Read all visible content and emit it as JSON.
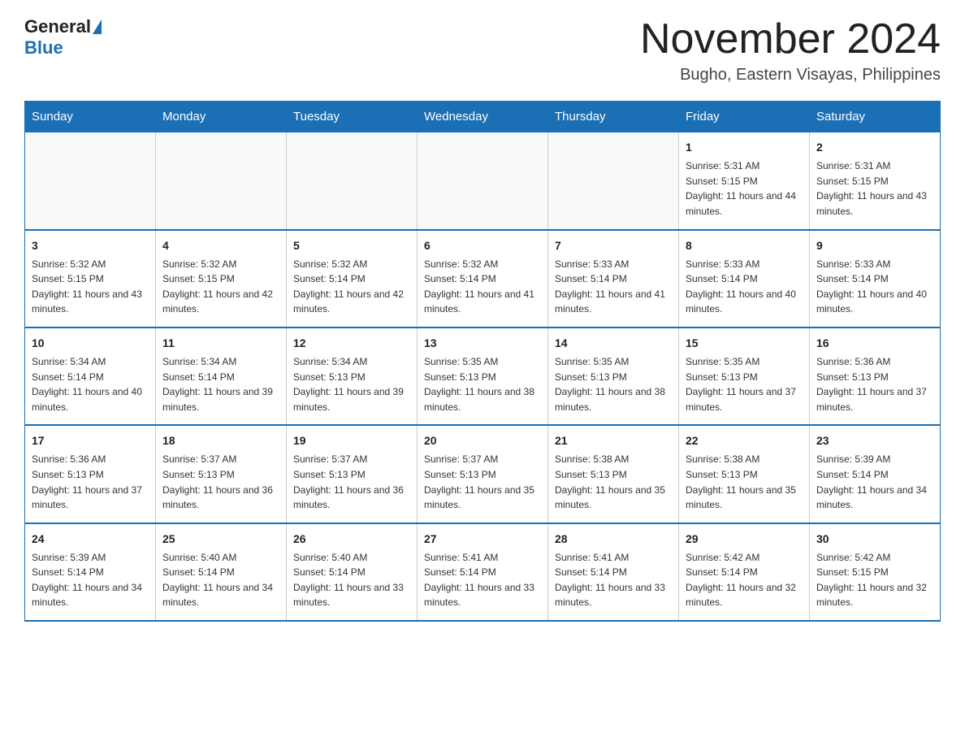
{
  "header": {
    "logo_general": "General",
    "logo_blue": "Blue",
    "month_title": "November 2024",
    "subtitle": "Bugho, Eastern Visayas, Philippines"
  },
  "days_of_week": [
    "Sunday",
    "Monday",
    "Tuesday",
    "Wednesday",
    "Thursday",
    "Friday",
    "Saturday"
  ],
  "weeks": [
    [
      {
        "day": "",
        "info": ""
      },
      {
        "day": "",
        "info": ""
      },
      {
        "day": "",
        "info": ""
      },
      {
        "day": "",
        "info": ""
      },
      {
        "day": "",
        "info": ""
      },
      {
        "day": "1",
        "info": "Sunrise: 5:31 AM\nSunset: 5:15 PM\nDaylight: 11 hours and 44 minutes."
      },
      {
        "day": "2",
        "info": "Sunrise: 5:31 AM\nSunset: 5:15 PM\nDaylight: 11 hours and 43 minutes."
      }
    ],
    [
      {
        "day": "3",
        "info": "Sunrise: 5:32 AM\nSunset: 5:15 PM\nDaylight: 11 hours and 43 minutes."
      },
      {
        "day": "4",
        "info": "Sunrise: 5:32 AM\nSunset: 5:15 PM\nDaylight: 11 hours and 42 minutes."
      },
      {
        "day": "5",
        "info": "Sunrise: 5:32 AM\nSunset: 5:14 PM\nDaylight: 11 hours and 42 minutes."
      },
      {
        "day": "6",
        "info": "Sunrise: 5:32 AM\nSunset: 5:14 PM\nDaylight: 11 hours and 41 minutes."
      },
      {
        "day": "7",
        "info": "Sunrise: 5:33 AM\nSunset: 5:14 PM\nDaylight: 11 hours and 41 minutes."
      },
      {
        "day": "8",
        "info": "Sunrise: 5:33 AM\nSunset: 5:14 PM\nDaylight: 11 hours and 40 minutes."
      },
      {
        "day": "9",
        "info": "Sunrise: 5:33 AM\nSunset: 5:14 PM\nDaylight: 11 hours and 40 minutes."
      }
    ],
    [
      {
        "day": "10",
        "info": "Sunrise: 5:34 AM\nSunset: 5:14 PM\nDaylight: 11 hours and 40 minutes."
      },
      {
        "day": "11",
        "info": "Sunrise: 5:34 AM\nSunset: 5:14 PM\nDaylight: 11 hours and 39 minutes."
      },
      {
        "day": "12",
        "info": "Sunrise: 5:34 AM\nSunset: 5:13 PM\nDaylight: 11 hours and 39 minutes."
      },
      {
        "day": "13",
        "info": "Sunrise: 5:35 AM\nSunset: 5:13 PM\nDaylight: 11 hours and 38 minutes."
      },
      {
        "day": "14",
        "info": "Sunrise: 5:35 AM\nSunset: 5:13 PM\nDaylight: 11 hours and 38 minutes."
      },
      {
        "day": "15",
        "info": "Sunrise: 5:35 AM\nSunset: 5:13 PM\nDaylight: 11 hours and 37 minutes."
      },
      {
        "day": "16",
        "info": "Sunrise: 5:36 AM\nSunset: 5:13 PM\nDaylight: 11 hours and 37 minutes."
      }
    ],
    [
      {
        "day": "17",
        "info": "Sunrise: 5:36 AM\nSunset: 5:13 PM\nDaylight: 11 hours and 37 minutes."
      },
      {
        "day": "18",
        "info": "Sunrise: 5:37 AM\nSunset: 5:13 PM\nDaylight: 11 hours and 36 minutes."
      },
      {
        "day": "19",
        "info": "Sunrise: 5:37 AM\nSunset: 5:13 PM\nDaylight: 11 hours and 36 minutes."
      },
      {
        "day": "20",
        "info": "Sunrise: 5:37 AM\nSunset: 5:13 PM\nDaylight: 11 hours and 35 minutes."
      },
      {
        "day": "21",
        "info": "Sunrise: 5:38 AM\nSunset: 5:13 PM\nDaylight: 11 hours and 35 minutes."
      },
      {
        "day": "22",
        "info": "Sunrise: 5:38 AM\nSunset: 5:13 PM\nDaylight: 11 hours and 35 minutes."
      },
      {
        "day": "23",
        "info": "Sunrise: 5:39 AM\nSunset: 5:14 PM\nDaylight: 11 hours and 34 minutes."
      }
    ],
    [
      {
        "day": "24",
        "info": "Sunrise: 5:39 AM\nSunset: 5:14 PM\nDaylight: 11 hours and 34 minutes."
      },
      {
        "day": "25",
        "info": "Sunrise: 5:40 AM\nSunset: 5:14 PM\nDaylight: 11 hours and 34 minutes."
      },
      {
        "day": "26",
        "info": "Sunrise: 5:40 AM\nSunset: 5:14 PM\nDaylight: 11 hours and 33 minutes."
      },
      {
        "day": "27",
        "info": "Sunrise: 5:41 AM\nSunset: 5:14 PM\nDaylight: 11 hours and 33 minutes."
      },
      {
        "day": "28",
        "info": "Sunrise: 5:41 AM\nSunset: 5:14 PM\nDaylight: 11 hours and 33 minutes."
      },
      {
        "day": "29",
        "info": "Sunrise: 5:42 AM\nSunset: 5:14 PM\nDaylight: 11 hours and 32 minutes."
      },
      {
        "day": "30",
        "info": "Sunrise: 5:42 AM\nSunset: 5:15 PM\nDaylight: 11 hours and 32 minutes."
      }
    ]
  ]
}
